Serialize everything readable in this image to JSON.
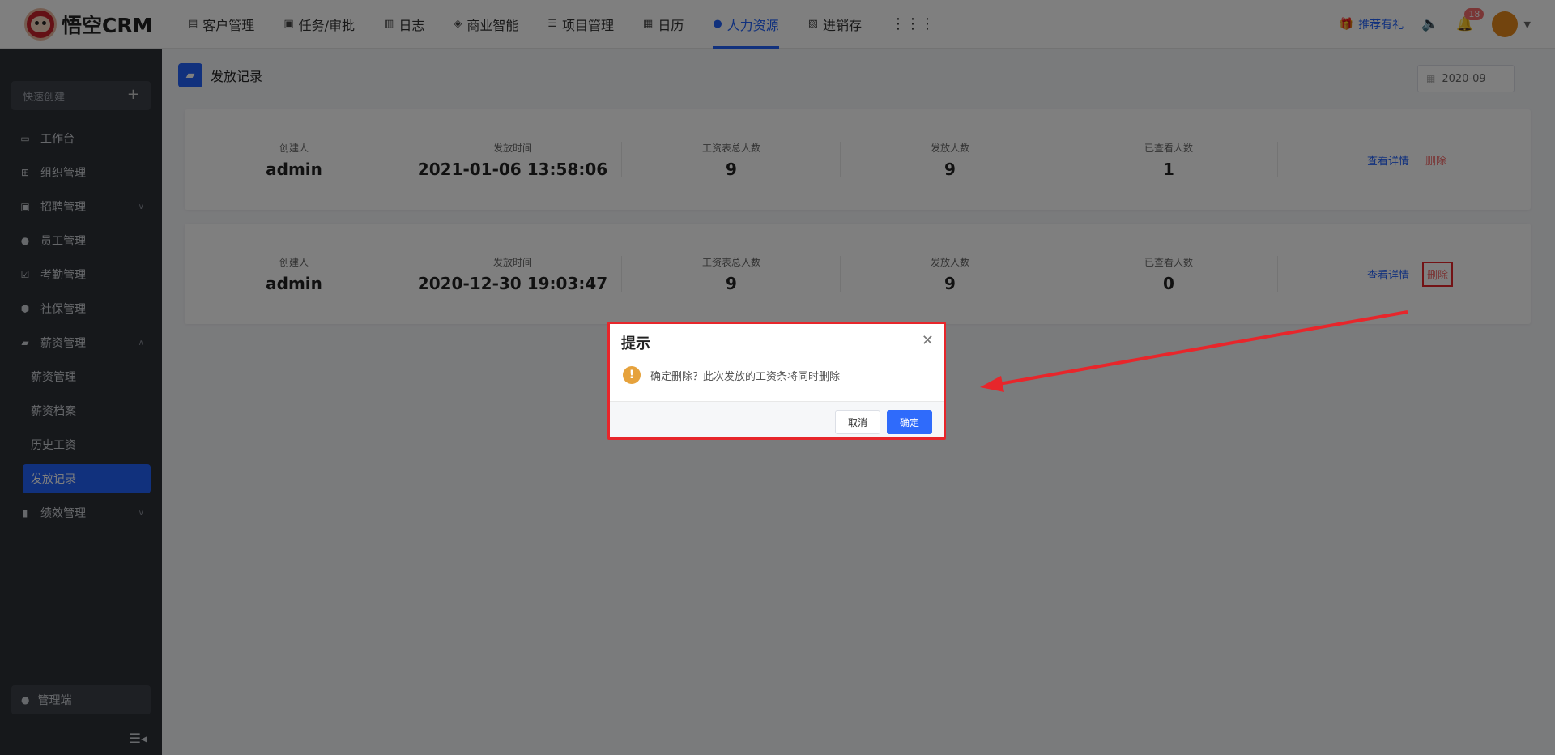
{
  "app": {
    "logo_text": "悟空CRM"
  },
  "nav": [
    {
      "label": "客户管理",
      "icon": "building-icon"
    },
    {
      "label": "任务/审批",
      "icon": "briefcase-icon"
    },
    {
      "label": "日志",
      "icon": "notebook-icon"
    },
    {
      "label": "商业智能",
      "icon": "cube-icon"
    },
    {
      "label": "项目管理",
      "icon": "list-icon"
    },
    {
      "label": "日历",
      "icon": "calendar-icon"
    },
    {
      "label": "人力资源",
      "icon": "users-icon",
      "active": true
    },
    {
      "label": "进销存",
      "icon": "inventory-icon"
    }
  ],
  "topright": {
    "promo": "推荐有礼",
    "notifications": "18"
  },
  "sidebar": {
    "quick_create": "快速创建",
    "items": [
      {
        "label": "工作台"
      },
      {
        "label": "组织管理"
      },
      {
        "label": "招聘管理"
      },
      {
        "label": "员工管理"
      },
      {
        "label": "考勤管理"
      },
      {
        "label": "社保管理"
      },
      {
        "label": "薪资管理"
      }
    ],
    "sub_items": [
      {
        "label": "薪资管理"
      },
      {
        "label": "薪资档案"
      },
      {
        "label": "历史工资"
      },
      {
        "label": "发放记录"
      }
    ],
    "after": {
      "label": "绩效管理"
    },
    "admin": "管理端"
  },
  "page": {
    "title": "发放记录",
    "month": "2020-09"
  },
  "columns": [
    "创建人",
    "发放时间",
    "工资表总人数",
    "发放人数",
    "已查看人数"
  ],
  "records": [
    {
      "creator": "admin",
      "time": "2021-01-06 13:58:06",
      "total": "9",
      "sent": "9",
      "viewed": "1"
    },
    {
      "creator": "admin",
      "time": "2020-12-30 19:03:47",
      "total": "9",
      "sent": "9",
      "viewed": "0"
    }
  ],
  "actions": {
    "detail": "查看详情",
    "delete": "删除"
  },
  "dialog": {
    "title": "提示",
    "message": "确定删除？此次发放的工资条将同时删除",
    "cancel": "取消",
    "confirm": "确定"
  },
  "colors": {
    "accent": "#2362fb",
    "danger": "#f56c6c",
    "annotation": "#e7262b",
    "warning": "#e6a23c"
  }
}
